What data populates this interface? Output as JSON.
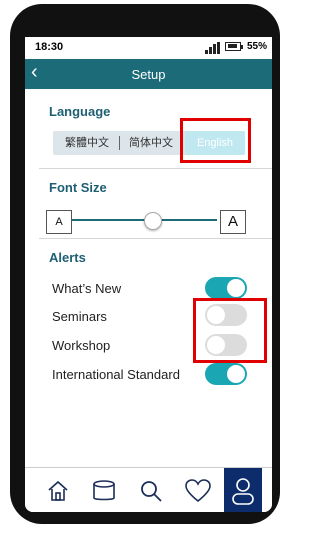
{
  "status_bar": {
    "time": "18:30",
    "battery": "55%"
  },
  "header": {
    "back_glyph": "‹",
    "title": "Setup"
  },
  "language": {
    "title": "Language",
    "options": [
      {
        "label": "繁體中文"
      },
      {
        "label": "简体中文"
      },
      {
        "label": "English",
        "selected": true
      }
    ]
  },
  "font_size": {
    "title": "Font Size",
    "small_label": "A",
    "large_label": "A",
    "level": 0.55
  },
  "alerts": {
    "title": "Alerts",
    "items": [
      {
        "label": "What’s New",
        "on": true
      },
      {
        "label": "Seminars",
        "on": false
      },
      {
        "label": "Workshop",
        "on": false
      },
      {
        "label": "International Standard",
        "on": true
      }
    ]
  },
  "tabbar": {
    "tabs": [
      {
        "icon": "home-icon"
      },
      {
        "icon": "database-icon"
      },
      {
        "icon": "search-icon"
      },
      {
        "icon": "heart-icon"
      },
      {
        "icon": "user-icon",
        "active": true
      }
    ]
  },
  "colors": {
    "header": "#1b6b78",
    "accent": "#1ba6b3",
    "section_title": "#1f5f74",
    "highlight": "#e00000",
    "active_tab": "#0d2c6b"
  }
}
